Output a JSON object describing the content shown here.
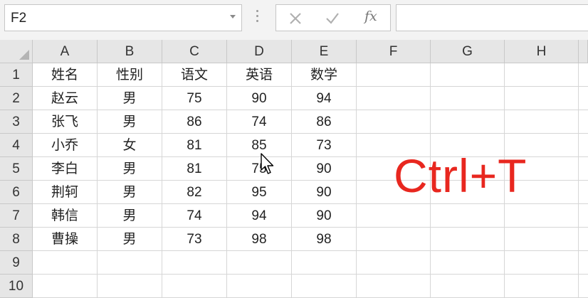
{
  "formula_bar": {
    "name_box": "F2",
    "fx_label": "fx",
    "formula_value": ""
  },
  "columns": [
    {
      "label": "A",
      "w": 91
    },
    {
      "label": "B",
      "w": 91
    },
    {
      "label": "C",
      "w": 91
    },
    {
      "label": "D",
      "w": 91
    },
    {
      "label": "E",
      "w": 91
    },
    {
      "label": "F",
      "w": 104
    },
    {
      "label": "G",
      "w": 104
    },
    {
      "label": "H",
      "w": 104
    }
  ],
  "rows": [
    "1",
    "2",
    "3",
    "4",
    "5",
    "6",
    "7",
    "8",
    "9",
    "10"
  ],
  "table": {
    "headers": [
      "姓名",
      "性别",
      "语文",
      "英语",
      "数学"
    ],
    "rows": [
      [
        "赵云",
        "男",
        "75",
        "90",
        "94"
      ],
      [
        "张飞",
        "男",
        "86",
        "74",
        "86"
      ],
      [
        "小乔",
        "女",
        "81",
        "85",
        "73"
      ],
      [
        "李白",
        "男",
        "81",
        "75",
        "90"
      ],
      [
        "荆轲",
        "男",
        "82",
        "95",
        "90"
      ],
      [
        "韩信",
        "男",
        "74",
        "94",
        "90"
      ],
      [
        "曹操",
        "男",
        "73",
        "98",
        "98"
      ]
    ]
  },
  "overlay_text": "Ctrl+T",
  "colors": {
    "overlay": "#e8271f",
    "header_bg": "#e6e6e6",
    "gridline": "#d6d6d6"
  },
  "icons": [
    "dropdown-arrow-icon",
    "more-vertical-icon",
    "cancel-x-icon",
    "enter-check-icon",
    "insert-function-icon",
    "select-all-triangle-icon",
    "mouse-pointer-icon"
  ]
}
